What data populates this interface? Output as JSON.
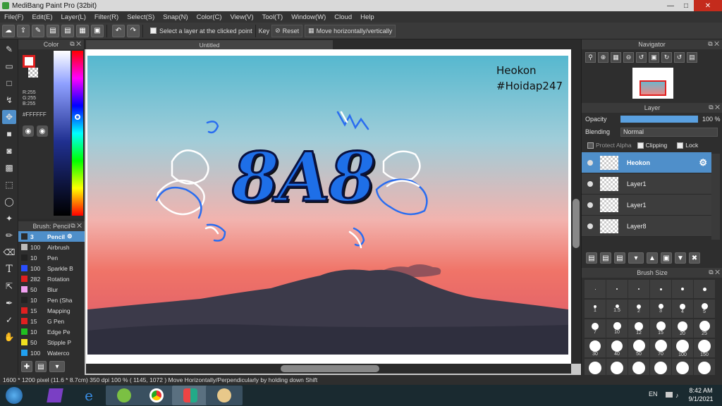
{
  "window": {
    "title": "MediBang Paint Pro (32bit)"
  },
  "menu": [
    "File(F)",
    "Edit(E)",
    "Layer(L)",
    "Filter(R)",
    "Select(S)",
    "Snap(N)",
    "Color(C)",
    "View(V)",
    "Tool(T)",
    "Window(W)",
    "Cloud",
    "Help"
  ],
  "toolbar": {
    "select_layer_label": "Select a layer at the clicked point",
    "key_label": "Key",
    "reset_label": "Reset",
    "move_label": "Move horizontally/vertically"
  },
  "color_panel": {
    "title": "Color",
    "r": "R:255",
    "g": "G:255",
    "b": "B:255",
    "hex": "#FFFFFF"
  },
  "brush_panel": {
    "title": "Brush: Pencil",
    "items": [
      {
        "size": "3",
        "name": "Pencil",
        "color": "#2b2b2b",
        "selected": true
      },
      {
        "size": "100",
        "name": "Airbrush",
        "color": "#bbbbbb"
      },
      {
        "size": "10",
        "name": "Pen",
        "color": "#222222"
      },
      {
        "size": "100",
        "name": "Sparkle B",
        "color": "#2a4fff"
      },
      {
        "size": "282",
        "name": "Rotation",
        "color": "#e02020"
      },
      {
        "size": "50",
        "name": "Blur",
        "color": "#f0a0f0"
      },
      {
        "size": "10",
        "name": "Pen (Sha",
        "color": "#222222"
      },
      {
        "size": "15",
        "name": "Mapping",
        "color": "#e02020"
      },
      {
        "size": "15",
        "name": "G Pen",
        "color": "#e02020"
      },
      {
        "size": "10",
        "name": "Edge Pe",
        "color": "#20c020"
      },
      {
        "size": "50",
        "name": "Stipple P",
        "color": "#f0e020"
      },
      {
        "size": "100",
        "name": "Waterco",
        "color": "#20a0f0"
      }
    ]
  },
  "canvas": {
    "tab_title": "Untitled",
    "text_line1": "Heokon",
    "text_line2": "#Hoidap247",
    "art_text": "8A8"
  },
  "navigator": {
    "title": "Navigator"
  },
  "layer_panel": {
    "title": "Layer",
    "opacity_label": "Opacity",
    "opacity_value": "100 %",
    "blending_label": "Blending",
    "blending_value": "Normal",
    "protect_alpha": "Protect Alpha",
    "clipping": "Clipping",
    "lock": "Lock",
    "layers": [
      {
        "name": "Heokon",
        "selected": true
      },
      {
        "name": "Layer1"
      },
      {
        "name": "Layer1"
      },
      {
        "name": "Layer8"
      }
    ]
  },
  "brush_size": {
    "title": "Brush Size",
    "sizes": [
      "",
      "",
      "",
      "",
      "",
      "",
      "1",
      "1.5",
      "2",
      "3",
      "4",
      "5",
      "7",
      "10",
      "12",
      "15",
      "20",
      "25",
      "30",
      "40",
      "50",
      "70",
      "100",
      "150",
      "",
      "",
      "",
      "",
      "",
      ""
    ]
  },
  "status": {
    "text": "1600 * 1200 pixel   (11.6 * 8.7cm)   350 dpi   100 %   ( 1145, 1072 )   Move Horizontally/Perpendicularly by holding down Shift"
  },
  "taskbar": {
    "lang": "EN",
    "time": "8:42 AM",
    "date": "9/1/2021"
  }
}
